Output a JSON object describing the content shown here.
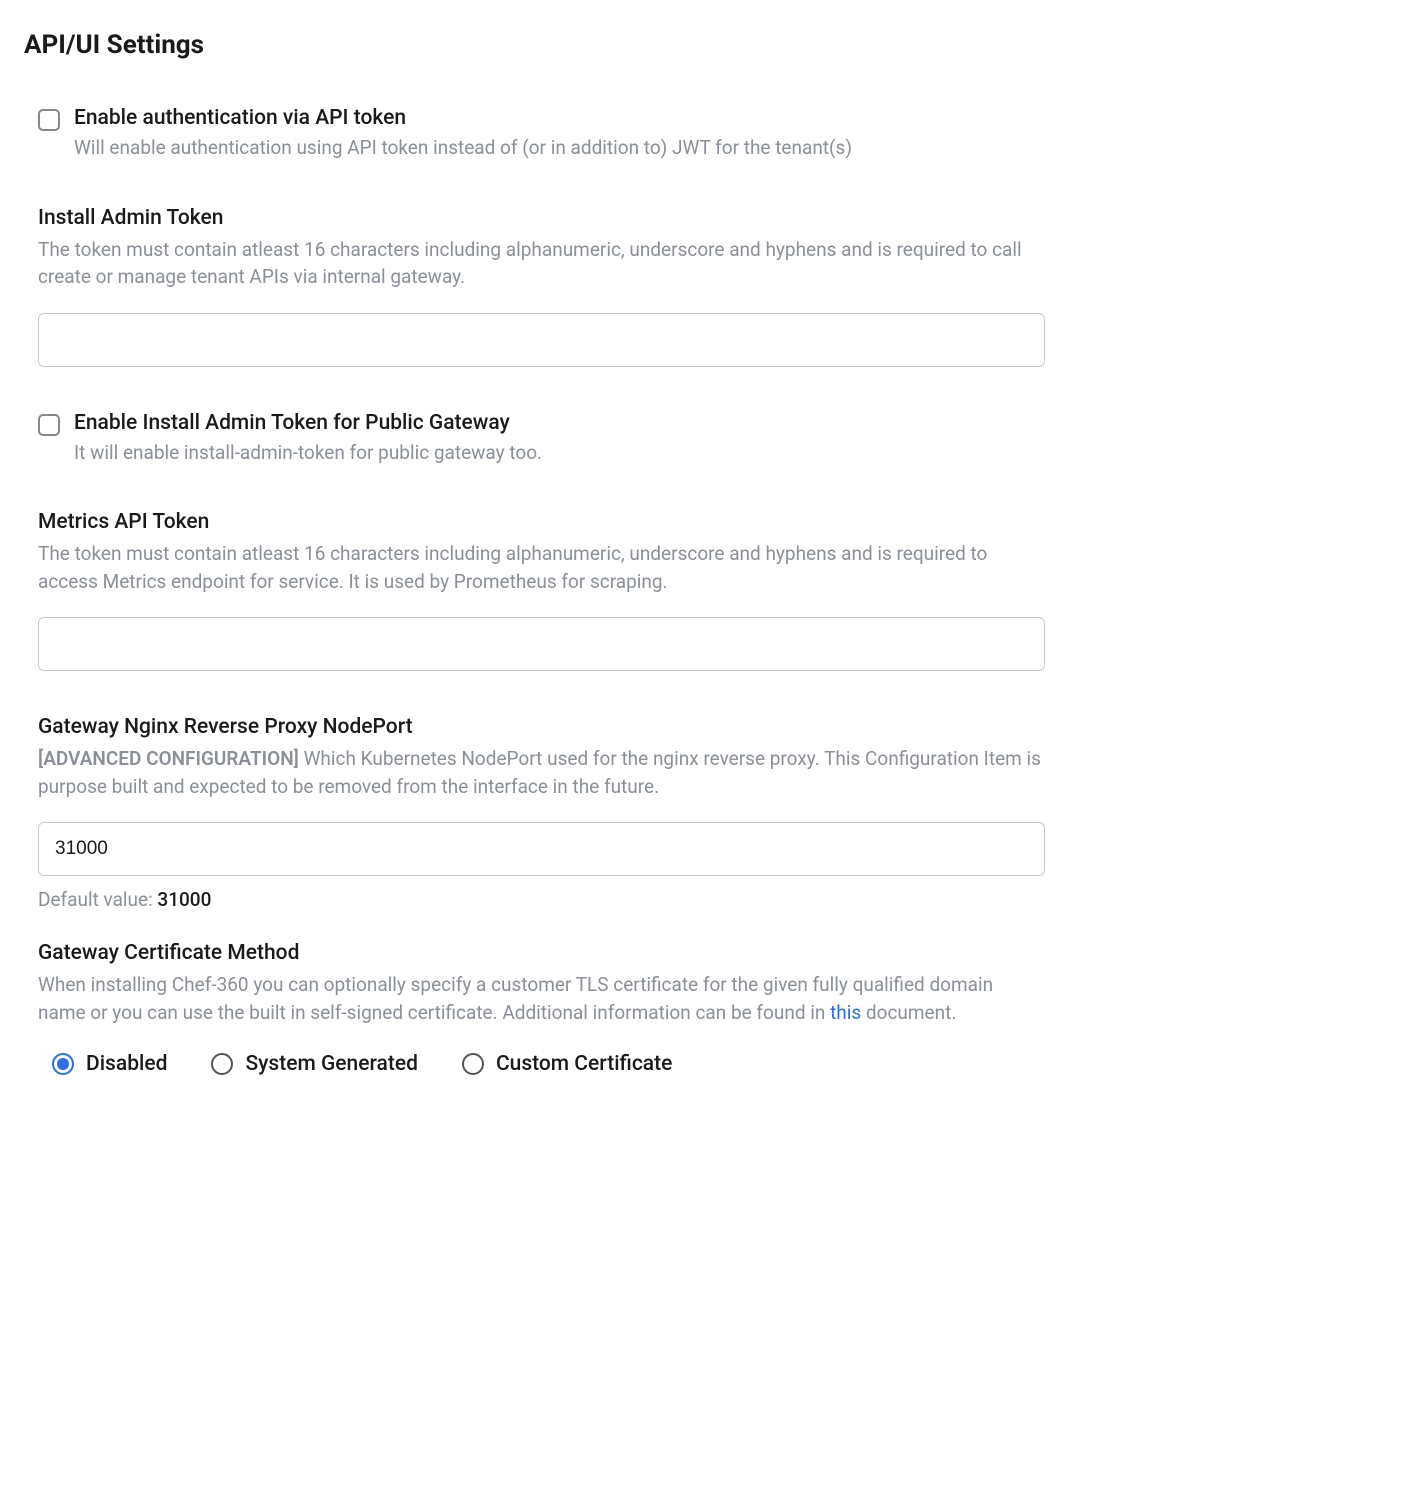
{
  "section_title": "API/UI Settings",
  "enable_api_token": {
    "label": "Enable authentication via API token",
    "desc": "Will enable authentication using API token instead of (or in addition to) JWT for the tenant(s)",
    "checked": false
  },
  "install_admin_token": {
    "label": "Install Admin Token",
    "desc": "The token must contain atleast 16 characters including alphanumeric, underscore and hyphens and is required to call create or manage tenant APIs via internal gateway.",
    "value": ""
  },
  "enable_install_admin_public": {
    "label": "Enable Install Admin Token for Public Gateway",
    "desc": "It will enable install-admin-token for public gateway too.",
    "checked": false
  },
  "metrics_api_token": {
    "label": "Metrics API Token",
    "desc": "The token must contain atleast 16 characters including alphanumeric, underscore and hyphens and is required to access Metrics endpoint for service. It is used by Prometheus for scraping.",
    "value": ""
  },
  "gateway_nodeport": {
    "label": "Gateway Nginx Reverse Proxy NodePort",
    "desc_prefix": "[ADVANCED CONFIGURATION]",
    "desc_rest": " Which Kubernetes NodePort used for the nginx reverse proxy. This Configuration Item is purpose built and expected to be removed from the interface in the future.",
    "value": "31000",
    "default_label": "Default value: ",
    "default_value": "31000"
  },
  "gateway_cert": {
    "label": "Gateway Certificate Method",
    "desc_pre": "When installing Chef-360 you can optionally specify a customer TLS certificate for the given fully qualified domain name or you can use the built in self-signed certificate. Additional information can be found in ",
    "link_text": "this",
    "desc_post": " document.",
    "options": {
      "disabled": "Disabled",
      "system": "System Generated",
      "custom": "Custom Certificate"
    },
    "selected": "disabled"
  }
}
